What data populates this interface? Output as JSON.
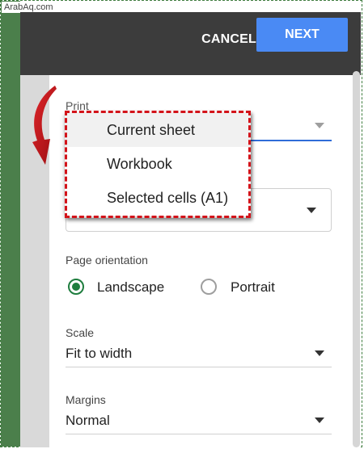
{
  "watermark": "ArabAq.com",
  "header": {
    "cancel_label": "CANCEL",
    "next_label": "NEXT"
  },
  "print_field": {
    "label": "Print"
  },
  "print_dropdown": {
    "options": [
      "Current sheet",
      "Workbook",
      "Selected cells (A1)"
    ],
    "highlighted": "Current sheet"
  },
  "orientation": {
    "label": "Page orientation",
    "options": [
      "Landscape",
      "Portrait"
    ],
    "selected": "Landscape"
  },
  "scale": {
    "label": "Scale",
    "value": "Fit to width"
  },
  "margins": {
    "label": "Margins",
    "value": "Normal"
  },
  "colors": {
    "header_bg": "#3c3c3c",
    "next_button": "#4a8af4",
    "radio_accent": "#1e7d3e",
    "highlight_dash": "#d3131a",
    "input_underline": "#2f6cd8"
  },
  "icons": [
    "dropdown-arrow-icon",
    "curved-red-arrow-icon",
    "radio-checked-icon",
    "radio-unchecked-icon"
  ]
}
